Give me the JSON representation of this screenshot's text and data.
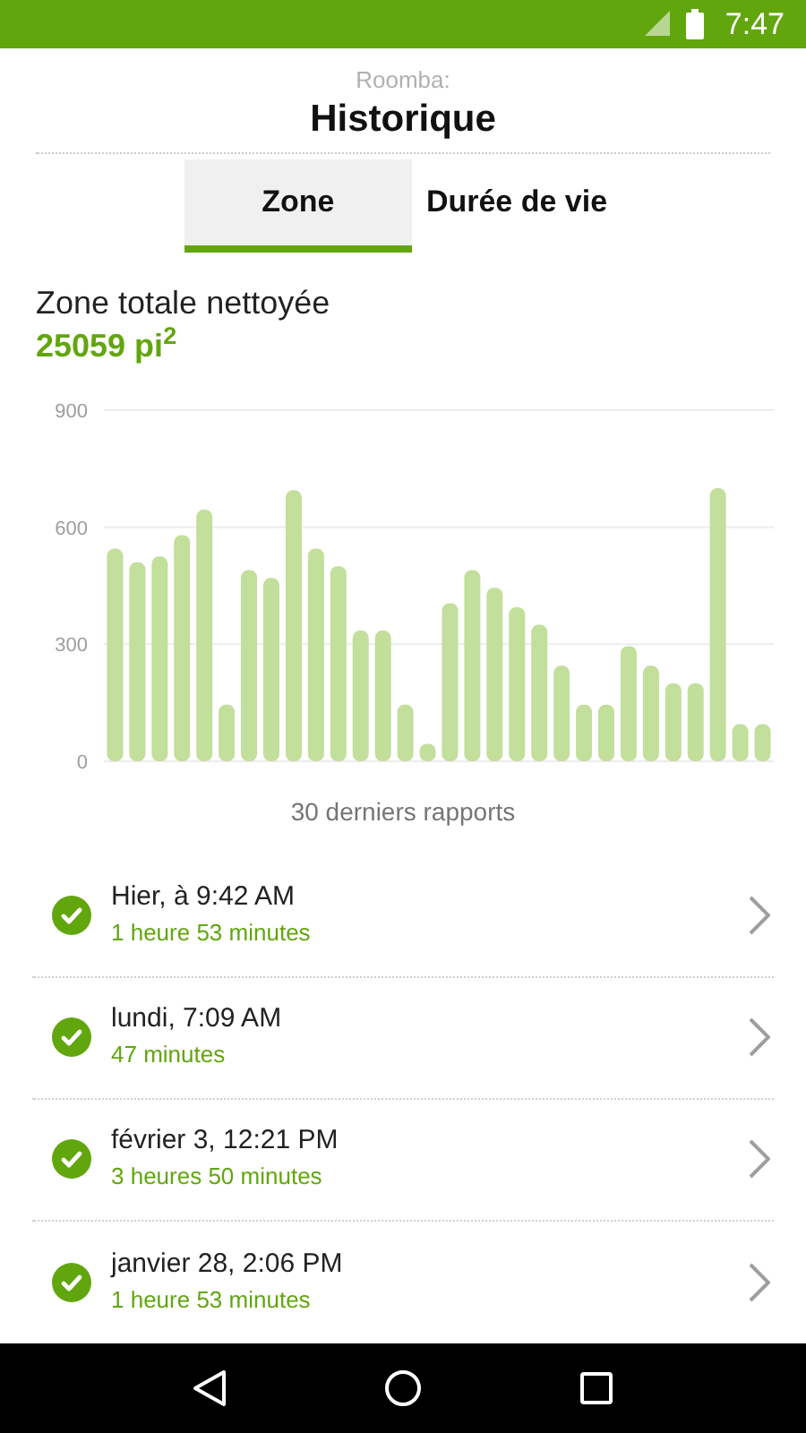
{
  "status_bar": {
    "time": "7:47"
  },
  "header": {
    "subtitle": "Roomba:",
    "title": "Historique"
  },
  "tabs": [
    {
      "label": "Zone",
      "selected": true
    },
    {
      "label": "Durée de vie",
      "selected": false
    }
  ],
  "summary": {
    "label": "Zone totale nettoyée",
    "value": "25059 pi$^{2}$"
  },
  "chart_data": {
    "type": "bar",
    "xlabel": "30 derniers rapports",
    "ylim": [
      0,
      900
    ],
    "yticks": [
      0,
      300,
      600,
      900
    ],
    "values": [
      545,
      510,
      525,
      580,
      645,
      145,
      490,
      470,
      695,
      545,
      500,
      335,
      335,
      145,
      45,
      405,
      490,
      445,
      395,
      350,
      245,
      145,
      145,
      295,
      245,
      200,
      200,
      700,
      95,
      95
    ]
  },
  "reports": [
    {
      "date": "Hier, à 9:42 AM",
      "duration": "1 heure 53 minutes",
      "completed": true
    },
    {
      "date": "lundi, 7:09 AM",
      "duration": "47 minutes",
      "completed": true
    },
    {
      "date": "février 3, 12:21 PM",
      "duration": "3 heures 50 minutes",
      "completed": true
    },
    {
      "date": "janvier 28, 2:06 PM",
      "duration": "1 heure 53 minutes",
      "completed": true
    }
  ]
}
